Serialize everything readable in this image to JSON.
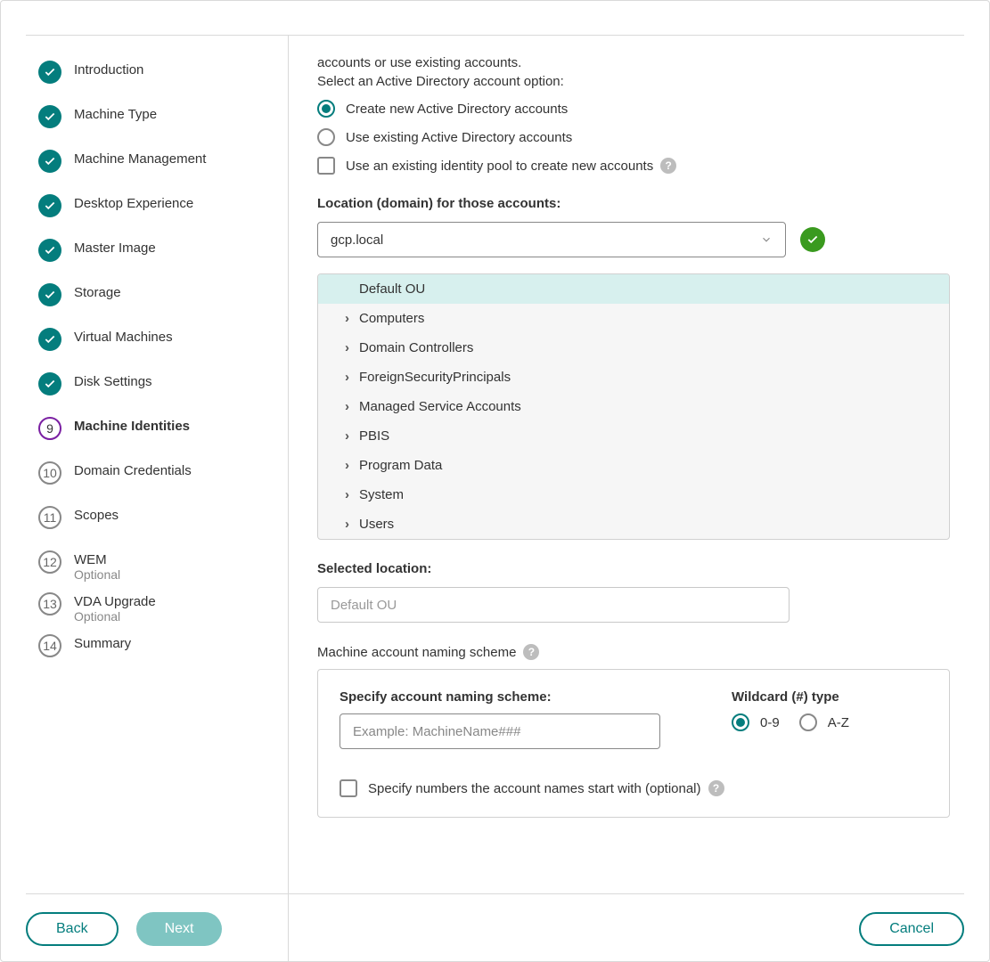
{
  "sidebar": {
    "steps": [
      {
        "label": "Introduction",
        "state": "done"
      },
      {
        "label": "Machine Type",
        "state": "done"
      },
      {
        "label": "Machine Management",
        "state": "done"
      },
      {
        "label": "Desktop Experience",
        "state": "done"
      },
      {
        "label": "Master Image",
        "state": "done"
      },
      {
        "label": "Storage",
        "state": "done"
      },
      {
        "label": "Virtual Machines",
        "state": "done"
      },
      {
        "label": "Disk Settings",
        "state": "done"
      },
      {
        "label": "Machine Identities",
        "num": "9",
        "state": "current"
      },
      {
        "label": "Domain Credentials",
        "num": "10",
        "state": "future"
      },
      {
        "label": "Scopes",
        "num": "11",
        "state": "future"
      },
      {
        "label": "WEM",
        "sub": "Optional",
        "num": "12",
        "state": "future"
      },
      {
        "label": "VDA Upgrade",
        "sub": "Optional",
        "num": "13",
        "state": "future"
      },
      {
        "label": "Summary",
        "num": "14",
        "state": "future"
      }
    ]
  },
  "main": {
    "intro_tail": "accounts or use existing accounts.",
    "prompt": "Select an Active Directory account option:",
    "radio_create": "Create new Active Directory accounts",
    "radio_existing": "Use existing Active Directory accounts",
    "checkbox_pool": "Use an existing identity pool to create new accounts",
    "location_label": "Location (domain) for those accounts:",
    "domain_value": "gcp.local",
    "ou_items": [
      {
        "label": "Default OU",
        "expandable": false,
        "selected": true
      },
      {
        "label": "Computers",
        "expandable": true
      },
      {
        "label": "Domain Controllers",
        "expandable": true
      },
      {
        "label": "ForeignSecurityPrincipals",
        "expandable": true
      },
      {
        "label": "Managed Service Accounts",
        "expandable": true
      },
      {
        "label": "PBIS",
        "expandable": true
      },
      {
        "label": "Program Data",
        "expandable": true
      },
      {
        "label": "System",
        "expandable": true
      },
      {
        "label": "Users",
        "expandable": true
      }
    ],
    "selected_location_label": "Selected location:",
    "selected_location_value": "Default OU",
    "naming_heading": "Machine account naming scheme",
    "naming_specify": "Specify account naming scheme:",
    "naming_placeholder": "Example: MachineName###",
    "wildcard_label": "Wildcard (#) type",
    "wildcard_09": "0-9",
    "wildcard_az": "A-Z",
    "naming_numbers_checkbox": "Specify numbers the account names start with (optional)"
  },
  "footer": {
    "back": "Back",
    "next": "Next",
    "cancel": "Cancel"
  }
}
